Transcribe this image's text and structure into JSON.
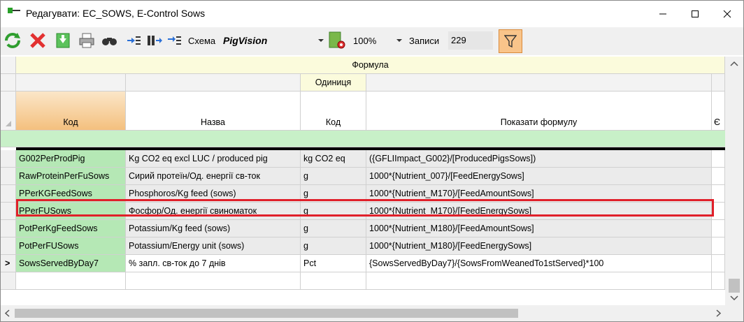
{
  "window": {
    "title": "Редагувати: EC_SOWS, E-Control Sows"
  },
  "toolbar": {
    "schema_label": "Схема",
    "schema_value": "PigVision",
    "zoom_value": "100%",
    "records_label": "Записи",
    "records_value": "229"
  },
  "grid": {
    "group_header": "Формула",
    "unit_group_header": "Одиниця",
    "columns": {
      "code": "Код",
      "name": "Назва",
      "unit_code": "Код",
      "formula": "Показати формулу",
      "extra": "Є"
    },
    "current_row_marker": ">",
    "rows": [
      {
        "code": "G002PerProdPig",
        "name": "Kg CO2 eq excl LUC / produced pig",
        "unit": "kg CO2 eq",
        "formula": "({GFLIImpact_G002}/[ProducedPigsSows])"
      },
      {
        "code": "RawProteinPerFuSows",
        "name": "Сирий протеїн/Од. енергії св-ток",
        "unit": "g",
        "formula": "1000*{Nutrient_007}/[FeedEnergySows]"
      },
      {
        "code": "PPerKGFeedSows",
        "name": "Phosphoros/Kg feed (sows)",
        "unit": "g",
        "formula": "1000*{Nutrient_M170}/[FeedAmountSows]"
      },
      {
        "code": "PPerFUSows",
        "name": "Фосфор/Од. енергії свиноматок",
        "unit": "g",
        "formula": "1000*{Nutrient_M170}/[FeedEnergySows]"
      },
      {
        "code": "PotPerKgFeedSows",
        "name": "Potassium/Kg feed (sows)",
        "unit": "g",
        "formula": "1000*{Nutrient_M180}/[FeedAmountSows]"
      },
      {
        "code": "PotPerFUSows",
        "name": "Potassium/Energy unit (sows)",
        "unit": "g",
        "formula": "1000*{Nutrient_M180}/[FeedEnergySows]"
      },
      {
        "code": "SowsServedByDay7",
        "name": "% запл. св-ток до 7 днів",
        "unit": "Pct",
        "formula": "{SowsServedByDay7}/{SowsFromWeanedTo1stServed}*100"
      }
    ]
  },
  "colors": {
    "highlight": "#e0202a",
    "code_column": "#b5e8b5",
    "filter_button": "#f9c48a"
  }
}
